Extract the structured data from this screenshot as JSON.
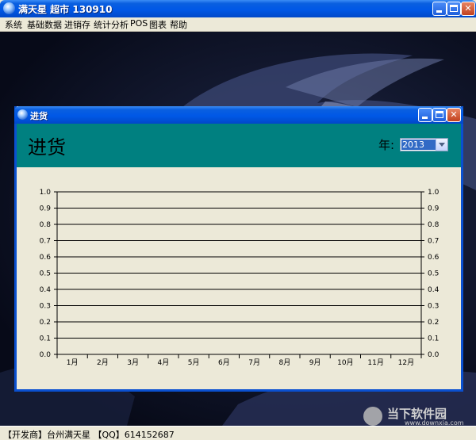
{
  "main_window": {
    "title": "满天星  超市  130910",
    "menu": [
      "系统",
      "基础数据",
      "进销存",
      "统计分析",
      "POS",
      "图表",
      "帮助"
    ],
    "status_text": "【开发商】台州满天星 【QQ】614152687"
  },
  "watermark": {
    "text": "当下软件园",
    "subtext": "www.downxia.com"
  },
  "child_window": {
    "title": "进货",
    "header_title": "进货",
    "year_label": "年:",
    "year_value": "2013"
  },
  "chart_data": {
    "type": "line",
    "categories": [
      "1月",
      "2月",
      "3月",
      "4月",
      "5月",
      "6月",
      "7月",
      "8月",
      "9月",
      "10月",
      "11月",
      "12月"
    ],
    "series": [],
    "ylim": [
      0,
      1.0
    ],
    "yticks": [
      "0.0",
      "0.1",
      "0.2",
      "0.3",
      "0.4",
      "0.5",
      "0.6",
      "0.7",
      "0.8",
      "0.9",
      "1.0"
    ],
    "grid": true,
    "secondary_y_axis": true
  },
  "colors": {
    "title_blue": "#0058e6",
    "header_teal": "#008080",
    "panel_beige": "#ece9d8",
    "selection_blue": "#316ac5"
  }
}
